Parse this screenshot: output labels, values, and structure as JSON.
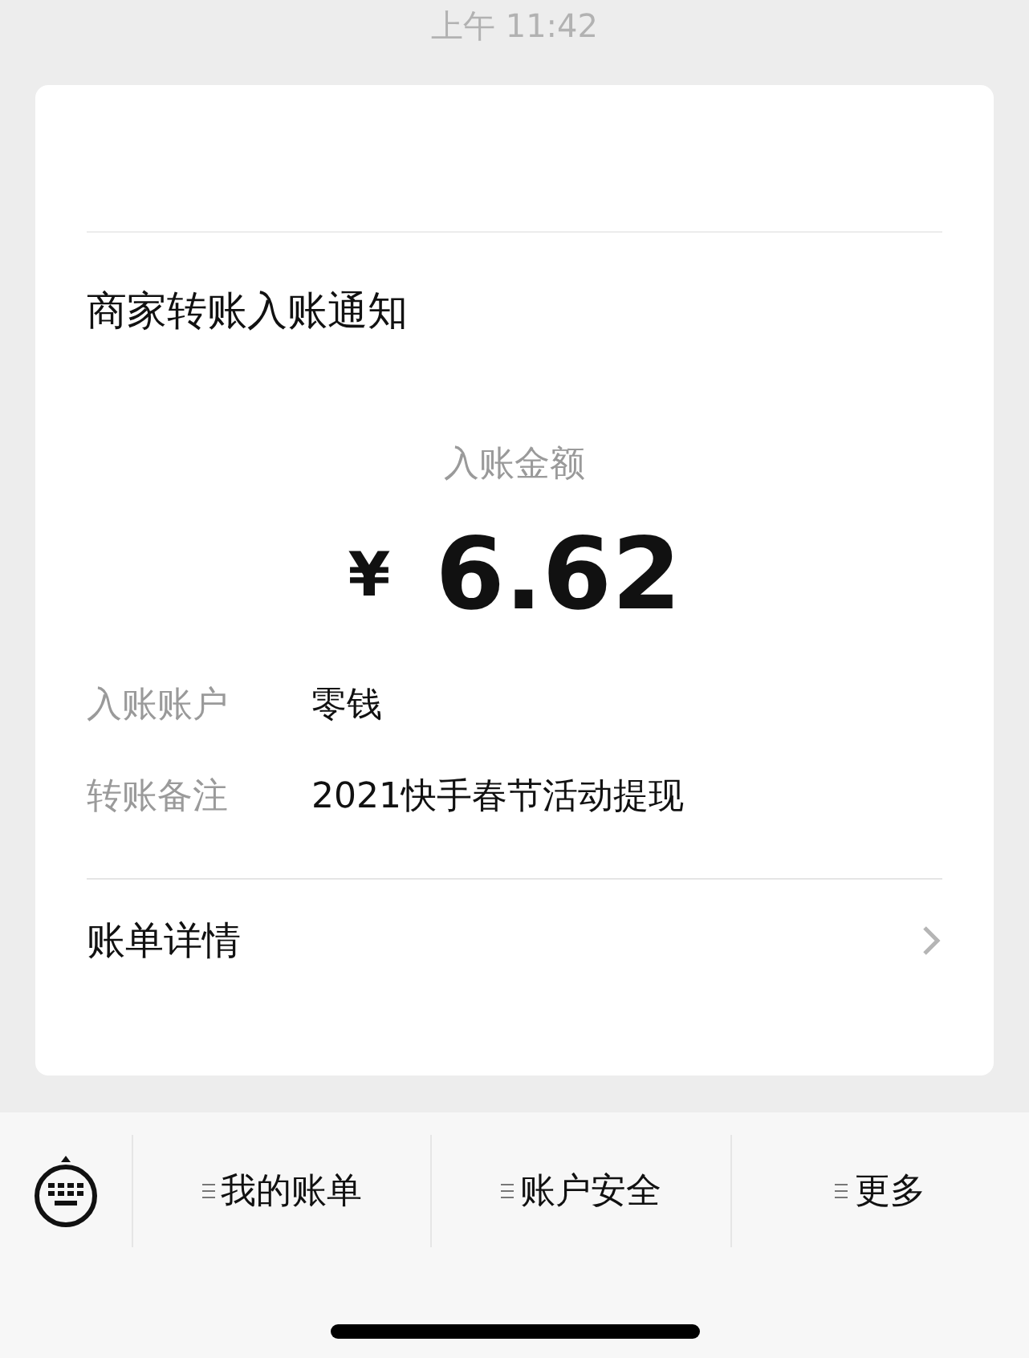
{
  "time": "上午 11:42",
  "card": {
    "title": "商家转账入账通知",
    "amount_label": "入账金额",
    "currency": "¥",
    "amount": "6.62",
    "fields": [
      {
        "label": "入账账户",
        "value": "零钱"
      },
      {
        "label": "转账备注",
        "value": "2021快手春节活动提现"
      }
    ],
    "details_link": "账单详情"
  },
  "menu": [
    "我的账单",
    "账户安全",
    "更多"
  ]
}
